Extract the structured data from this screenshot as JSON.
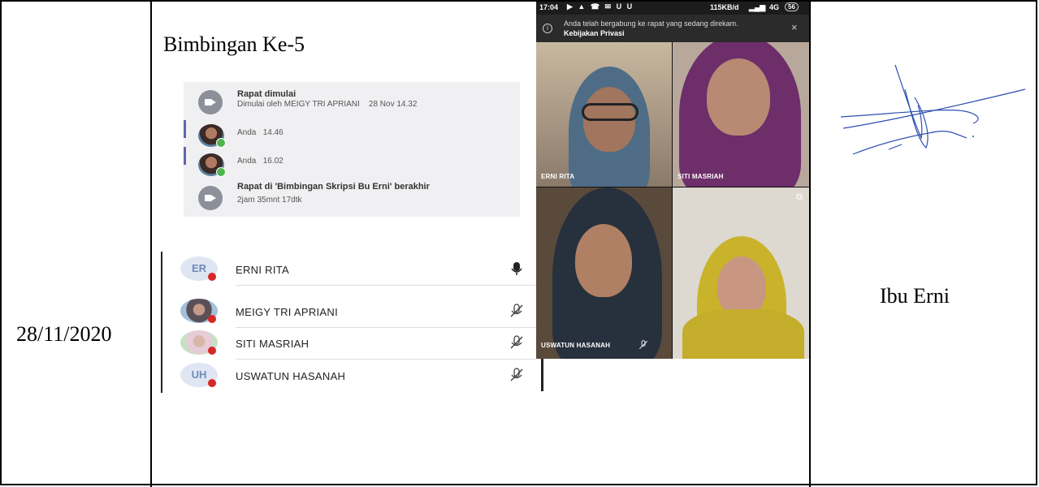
{
  "row": {
    "date": "28/11/2020",
    "session_title": "Bimbingan Ke-5",
    "signer_name": "Ibu Erni"
  },
  "chat_log": {
    "events": [
      {
        "title": "Rapat dimulai",
        "detail": "Dimulai oleh MEIGY TRI APRIANI    28 Nov 14.32"
      },
      {
        "title": "Rapat di 'Bimbingan Skripsi Bu Erni' berakhir",
        "detail": "2jam 35mnt 17dtk"
      }
    ],
    "messages": [
      {
        "sender": "Anda",
        "time": "14.46"
      },
      {
        "sender": "Anda",
        "time": "16.02"
      }
    ]
  },
  "participants": [
    {
      "initials": "ER",
      "name": "ERNI RITA",
      "mic": "mic-on-icon"
    },
    {
      "initials": "",
      "name": "MEIGY TRI APRIANI",
      "mic": "mic-muted-icon"
    },
    {
      "initials": "",
      "name": "SITI MASRIAH",
      "mic": "mic-muted-icon"
    },
    {
      "initials": "UH",
      "name": "USWATUN HASANAH",
      "mic": "mic-muted-icon"
    }
  ],
  "video_call": {
    "status_time": "17:04",
    "status_right": "115KB/d",
    "status_network": "4G",
    "status_battery": "56",
    "notice_text": "Anda telah bergabung ke rapat yang sedang direkam.",
    "notice_link": "Kebijakan Privasi",
    "tiles": [
      "ERNI RITA",
      "SITI MASRIAH",
      "USWATUN HASANAH",
      ""
    ]
  },
  "colors": {
    "accent": "#6264a7",
    "muted_red": "#d92626",
    "online_green": "#4db54d"
  }
}
